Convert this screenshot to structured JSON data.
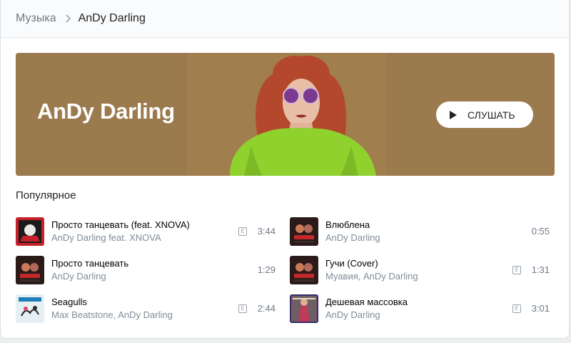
{
  "breadcrumb": {
    "root": "Музыка",
    "current": "AnDy Darling"
  },
  "banner": {
    "artist": "AnDy Darling",
    "listen_label": "СЛУШАТЬ",
    "bg_color": "#9b7a4d"
  },
  "popular": {
    "title": "Популярное",
    "tracks": [
      {
        "title": "Просто танцевать (feat. XNOVA)",
        "artist": "AnDy Darling feat. XNOVA",
        "duration": "3:44",
        "explicit": "E"
      },
      {
        "title": "Влюблена",
        "artist": "AnDy Darling",
        "duration": "0:55"
      },
      {
        "title": "Просто танцевать",
        "artist": "AnDy Darling",
        "duration": "1:29"
      },
      {
        "title": "Гучи (Cover)",
        "artist": "Муавия, AnDy Darling",
        "duration": "1:31",
        "explicit": "E"
      },
      {
        "title": "Seagulls",
        "artist": "Max Beatstone, AnDy Darling",
        "duration": "2:44",
        "explicit": "E"
      },
      {
        "title": "Дешевая массовка",
        "artist": "AnDy Darling",
        "duration": "3:01",
        "explicit": "E"
      }
    ]
  }
}
